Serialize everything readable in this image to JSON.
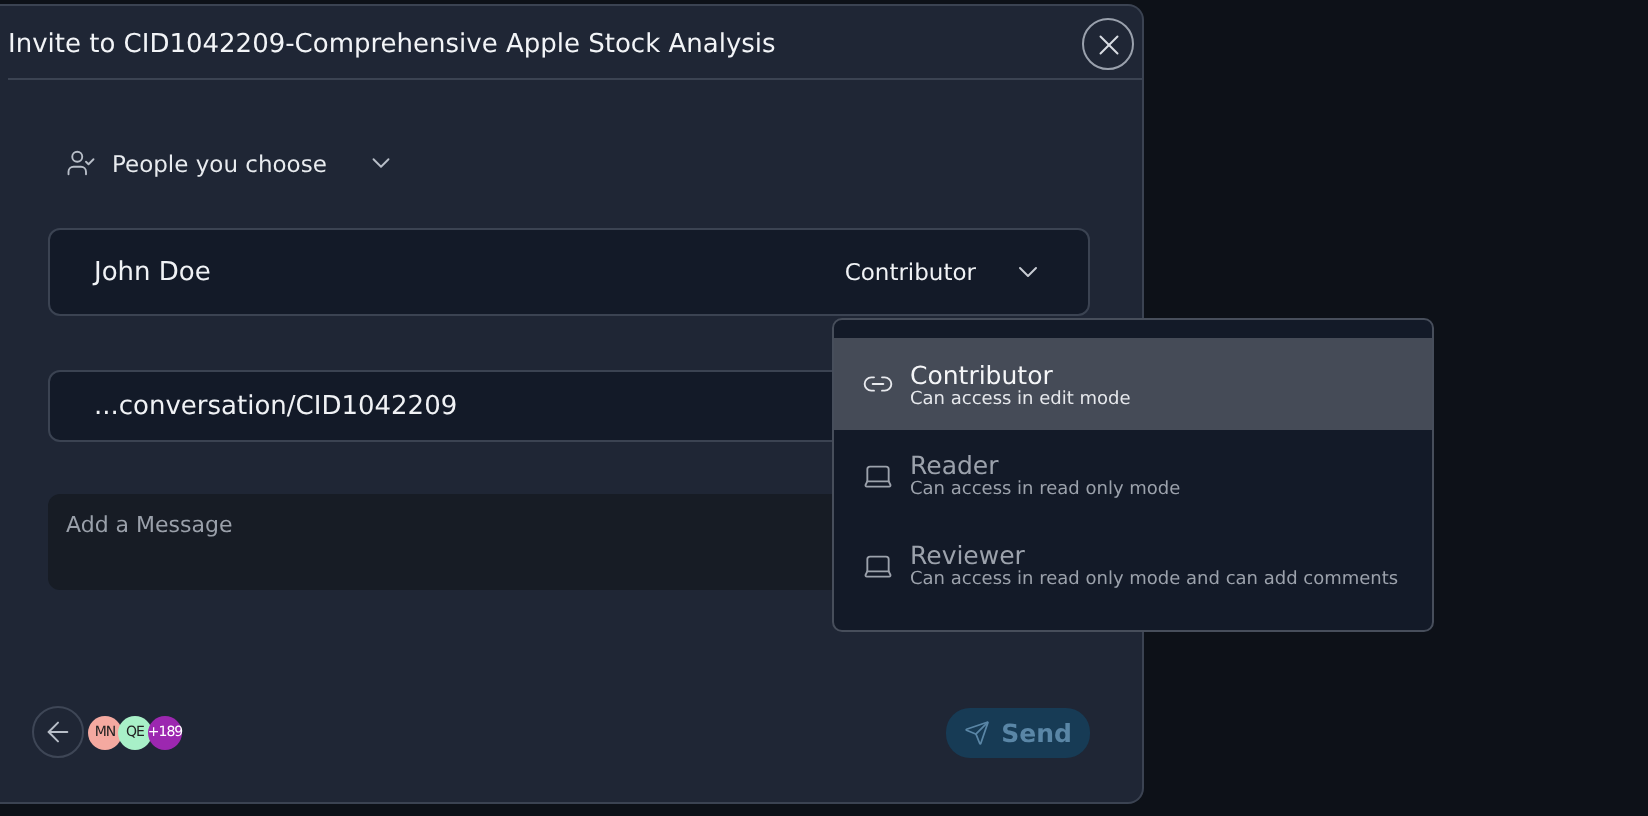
{
  "dialog": {
    "title": "Invite to CID1042209-Comprehensive Apple Stock Analysis"
  },
  "audience": {
    "label": "People you choose"
  },
  "invitee": {
    "name": "John Doe",
    "role": "Contributor"
  },
  "link": {
    "value": "...conversation/CID1042209"
  },
  "message": {
    "placeholder": "Add a Message"
  },
  "role_menu": [
    {
      "kind": "link",
      "title": "Contributor",
      "description": "Can access in edit mode",
      "selected": true
    },
    {
      "kind": "laptop",
      "title": "Reader",
      "description": "Can access in read only mode",
      "selected": false
    },
    {
      "kind": "laptop",
      "title": "Reviewer",
      "description": "Can access in read only mode and can add comments",
      "selected": false
    }
  ],
  "avatars": [
    {
      "initials": "MN",
      "color": "#f4a9a0"
    },
    {
      "initials": "QE",
      "color": "#a8f0c8"
    },
    {
      "initials": "+189",
      "color": "#9c27b0"
    }
  ],
  "send_button": {
    "label": "Send",
    "disabled": true
  }
}
